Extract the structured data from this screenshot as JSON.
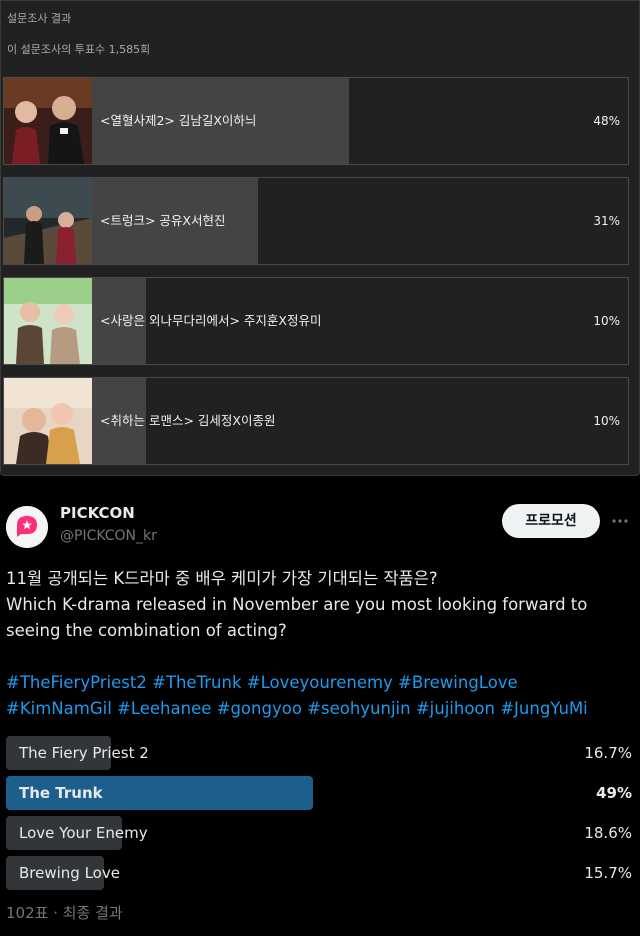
{
  "youtube_poll": {
    "title": "설문조사 결과",
    "vote_count_text": "이 설문조사의 투표수 1,585회",
    "options": [
      {
        "label": "<열혈사제2> 김남길X이하늬",
        "percent_text": "48%",
        "percent": 48
      },
      {
        "label": "<트렁크> 공유X서현진",
        "percent_text": "31%",
        "percent": 31
      },
      {
        "label": "<사랑은 외나무다리에서> 주지훈X정유미",
        "percent_text": "10%",
        "percent": 10
      },
      {
        "label": "<취하는 로맨스> 김세정X이종원",
        "percent_text": "10%",
        "percent": 10
      }
    ]
  },
  "tweet": {
    "display_name": "PICKCON",
    "handle": "@PICKCON_kr",
    "promo_button": "프로모션",
    "more_icon": "more-horizontal-icon",
    "text_ko": "11월 공개되는 K드라마 중 배우 케미가 가장 기대되는 작품은?",
    "text_en": "Which K-drama released in November are you most looking forward to seeing the combination of acting?",
    "hashtags_line1": "#TheFieryPriest2 #TheTrunk #Loveyourenemy #BrewingLove",
    "hashtags_line2": "#KimNamGil #Leehanee #gongyoo #seohyunjin #jujihoon #JungYuMi",
    "poll": [
      {
        "label": "The Fiery Priest 2",
        "percent_text": "16.7%",
        "percent": 16.7,
        "winner": false
      },
      {
        "label": "The Trunk",
        "percent_text": "49%",
        "percent": 49,
        "winner": true
      },
      {
        "label": "Love Your Enemy",
        "percent_text": "18.6%",
        "percent": 18.6,
        "winner": false
      },
      {
        "label": "Brewing Love",
        "percent_text": "15.7%",
        "percent": 15.7,
        "winner": false
      }
    ],
    "footer": "102표 · 최종 결과",
    "colors": {
      "link": "#1d9bf0",
      "winner_bar": "#1d5f8c",
      "bar": "#333639",
      "brand": "#ff2d7a"
    }
  }
}
